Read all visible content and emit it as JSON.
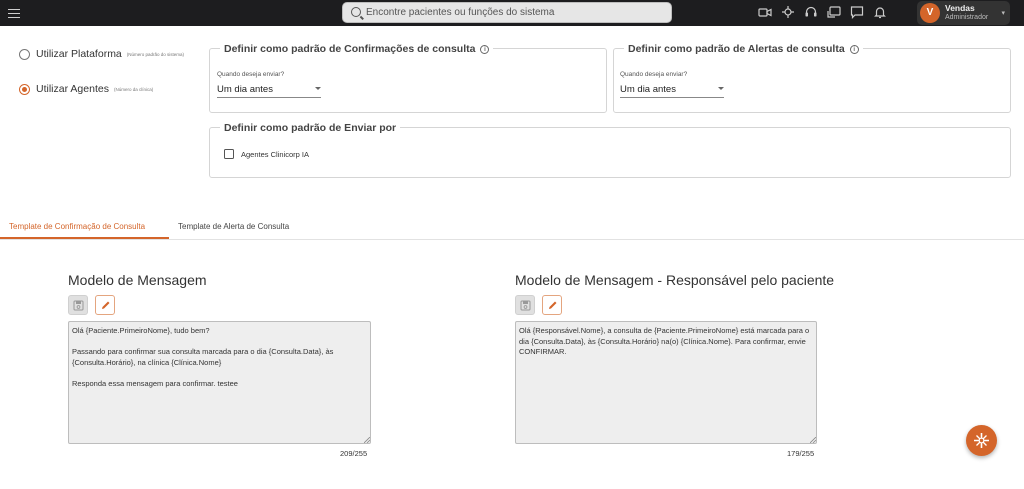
{
  "topbar": {
    "search_placeholder": "Encontre pacientes ou funções do sistema",
    "icons": [
      "menu-icon",
      "video-icon",
      "crosshair-icon",
      "headset-icon",
      "chat-transfer-icon",
      "chat-icon",
      "bell-icon"
    ],
    "user": {
      "initial": "V",
      "name": "Vendas",
      "role": "Administrador"
    }
  },
  "platform_options": [
    {
      "label": "Utilizar Plataforma",
      "note": "(Número padrão do sistema)",
      "selected": false
    },
    {
      "label": "Utilizar Agentes",
      "note": "(Número da clínica)",
      "selected": true
    }
  ],
  "confirmations_card": {
    "title": "Definir como padrão de Confirmações de consulta",
    "field_label": "Quando deseja enviar?",
    "value": "Um dia antes"
  },
  "alerts_card": {
    "title": "Definir como padrão de Alertas de consulta",
    "field_label": "Quando deseja enviar?",
    "value": "Um dia antes"
  },
  "send_by_card": {
    "title": "Definir como padrão de Enviar por",
    "checkbox_label": "Agentes Clinicorp IA",
    "checked": false
  },
  "tabs": [
    {
      "label": "Template de Confirmação de Consulta",
      "active": true
    },
    {
      "label": "Template de Alerta de Consulta",
      "active": false
    }
  ],
  "templates": [
    {
      "title": "Modelo de Mensagem",
      "text": "Olá {Paciente.PrimeiroNome}, tudo bem?\n\nPassando para confirmar sua consulta marcada para o dia {Consulta.Data}, às {Consulta.Horário}, na clínica {Clínica.Nome}\n\nResponda essa mensagem para confirmar. testee",
      "counter": "209/255"
    },
    {
      "title": "Modelo de Mensagem - Responsável pelo paciente",
      "text": "Olá {Responsável.Nome}, a consulta de {Paciente.PrimeiroNome} está marcada para o dia {Consulta.Data}, às {Consulta.Horário} na(o) {Clínica.Nome}. Para confirmar, envie CONFIRMAR.",
      "counter": "179/255"
    }
  ],
  "colors": {
    "accent": "#d4652a",
    "topbar": "#1d1d1f",
    "textarea_bg": "#eeeeee"
  }
}
